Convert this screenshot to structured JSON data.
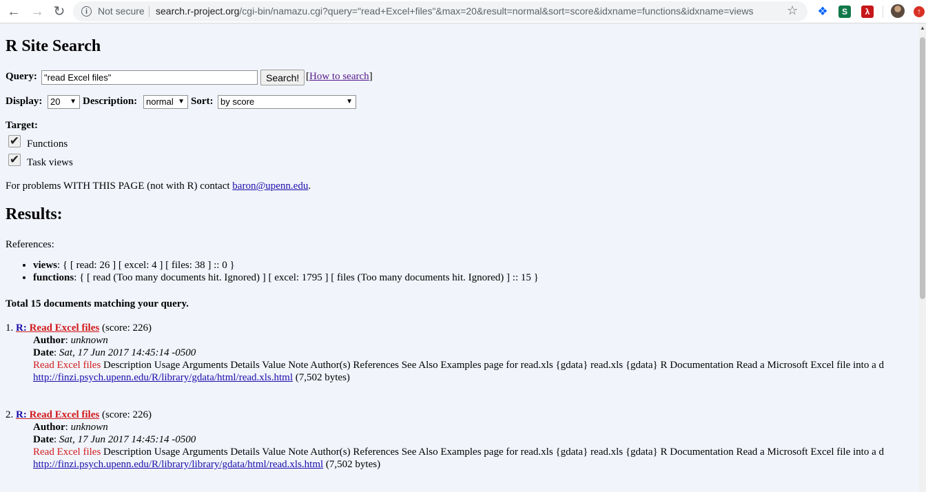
{
  "browser": {
    "security_label": "Not secure",
    "url_host": "search.r-project.org",
    "url_path": "/cgi-bin/namazu.cgi?query=\"read+Excel+files\"&max=20&result=normal&sort=score&idxname=functions&idxname=views"
  },
  "page": {
    "title": "R Site Search",
    "query_label": "Query:",
    "query_value": "\"read Excel files\"",
    "search_button": "Search!",
    "how_to_link": "How to search",
    "display_label": "Display:",
    "display_value": "20",
    "description_label": "Description:",
    "description_value": "normal",
    "sort_label": "Sort:",
    "sort_value": "by score",
    "target_label": "Target:",
    "targets": [
      {
        "label": "Functions",
        "checked": true
      },
      {
        "label": "Task views",
        "checked": true
      }
    ],
    "problems_text": "For problems WITH THIS PAGE (not with R) contact ",
    "problems_email": "baron@upenn.edu",
    "problems_end": "."
  },
  "results": {
    "heading": "Results:",
    "references_label": "References:",
    "references": [
      {
        "name": "views",
        "text": ": { [ read: 26 ] [ excel: 4 ] [ files: 38 ] :: 0 }"
      },
      {
        "name": "functions",
        "text": ": { [ read (Too many documents hit. Ignored) ] [ excel: 1795 ] [ files (Too many documents hit. Ignored) ] :: 15 }"
      }
    ],
    "total": "Total 15 documents matching your query.",
    "items": [
      {
        "index": "1.",
        "title_prefix": "R: ",
        "title_main": "Read Excel files",
        "score": "(score: 226)",
        "author_label": "Author",
        "author": "unknown",
        "date_label": "Date",
        "date": "Sat, 17 Jun 2017 14:45:14 -0500",
        "snippet_hl": "Read Excel files",
        "snippet": " Description Usage Arguments Details Value Note Author(s) References See Also Examples page for read.xls {gdata} read.xls {gdata} R Documentation Read a Microsoft Excel file into a d",
        "url": "http://finzi.psych.upenn.edu/R/library/gdata/html/read.xls.html",
        "size": "(7,502 bytes)"
      },
      {
        "index": "2.",
        "title_prefix": "R: ",
        "title_main": "Read Excel files",
        "score": "(score: 226)",
        "author_label": "Author",
        "author": "unknown",
        "date_label": "Date",
        "date": "Sat, 17 Jun 2017 14:45:14 -0500",
        "snippet_hl": "Read Excel files",
        "snippet": " Description Usage Arguments Details Value Note Author(s) References See Also Examples page for read.xls {gdata} read.xls {gdata} R Documentation Read a Microsoft Excel file into a d",
        "url": "http://finzi.psych.upenn.edu/R/library/library/gdata/html/read.xls.html",
        "size": "(7,502 bytes)"
      }
    ]
  },
  "icons": {
    "back": "arrow-left-icon",
    "forward": "arrow-right-icon",
    "reload": "reload-icon",
    "info": "info-icon",
    "bookmark": "star-icon",
    "dropbox": "dropbox-icon",
    "extension_s": "s-extension-icon",
    "pdf": "pdf-icon",
    "profile": "avatar",
    "update": "update-icon"
  },
  "colors": {
    "page_bg": "#f1f4fb",
    "link": "#1a0dab",
    "visited": "#551a8b",
    "highlight": "#d11a1a"
  }
}
